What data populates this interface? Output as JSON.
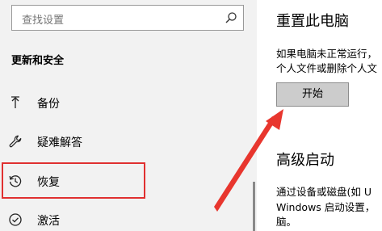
{
  "sidebar": {
    "search_placeholder": "查找设置",
    "section_heading": "更新和安全",
    "items": [
      {
        "label": "备份",
        "icon": "backup-arrow-icon"
      },
      {
        "label": "疑难解答",
        "icon": "wrench-icon"
      },
      {
        "label": "恢复",
        "icon": "recovery-history-icon"
      },
      {
        "label": "激活",
        "icon": "activation-check-icon"
      }
    ]
  },
  "main": {
    "reset_title": "重置此电脑",
    "reset_desc_line1": "如果电脑未正常运行，",
    "reset_desc_line2": "个人文件或删除个人文",
    "start_button_label": "开始",
    "advanced_title": "高级启动",
    "advanced_desc_line1": "通过设备或磁盘(如 U",
    "advanced_desc_line2": "Windows 启动设置，",
    "advanced_desc_line3": "脑。"
  },
  "annotation": {
    "highlight_color": "#e03030",
    "arrow_color": "#e8362e"
  }
}
